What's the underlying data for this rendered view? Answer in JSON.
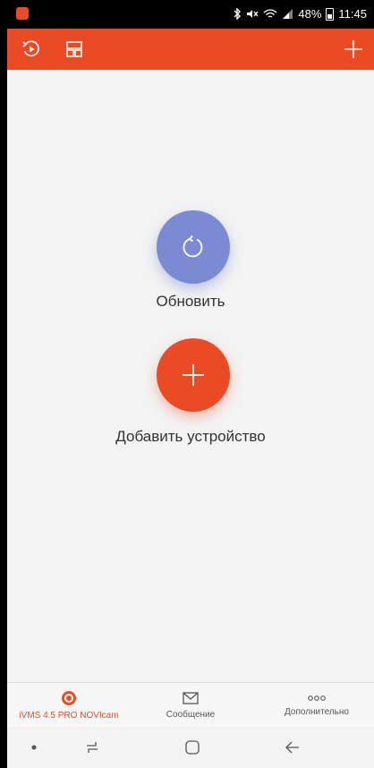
{
  "status_bar": {
    "signal_text": "48%",
    "time": "11:45",
    "icons": [
      "bluetooth-icon",
      "mute-icon",
      "wifi-icon",
      "signal-icon",
      "battery-icon"
    ]
  },
  "header": {
    "icons": [
      "playback-icon",
      "layout-icon",
      "add-icon"
    ]
  },
  "main": {
    "refresh_label": "Обновить",
    "add_device_label": "Добавить устройство",
    "colors": {
      "refresh": "#7b8bd3",
      "accent": "#ea4b24"
    }
  },
  "tabbar": {
    "tabs": [
      {
        "label": "iVMS 4.5 PRO NOVIcam",
        "icon": "camera-icon",
        "active": true
      },
      {
        "label": "Сообщение",
        "icon": "mail-icon",
        "active": false
      },
      {
        "label": "Дополнительно",
        "icon": "more-icon",
        "active": false
      }
    ]
  },
  "navbar": {
    "buttons": [
      "dot-icon",
      "recent-apps-icon",
      "home-icon",
      "back-icon"
    ]
  }
}
